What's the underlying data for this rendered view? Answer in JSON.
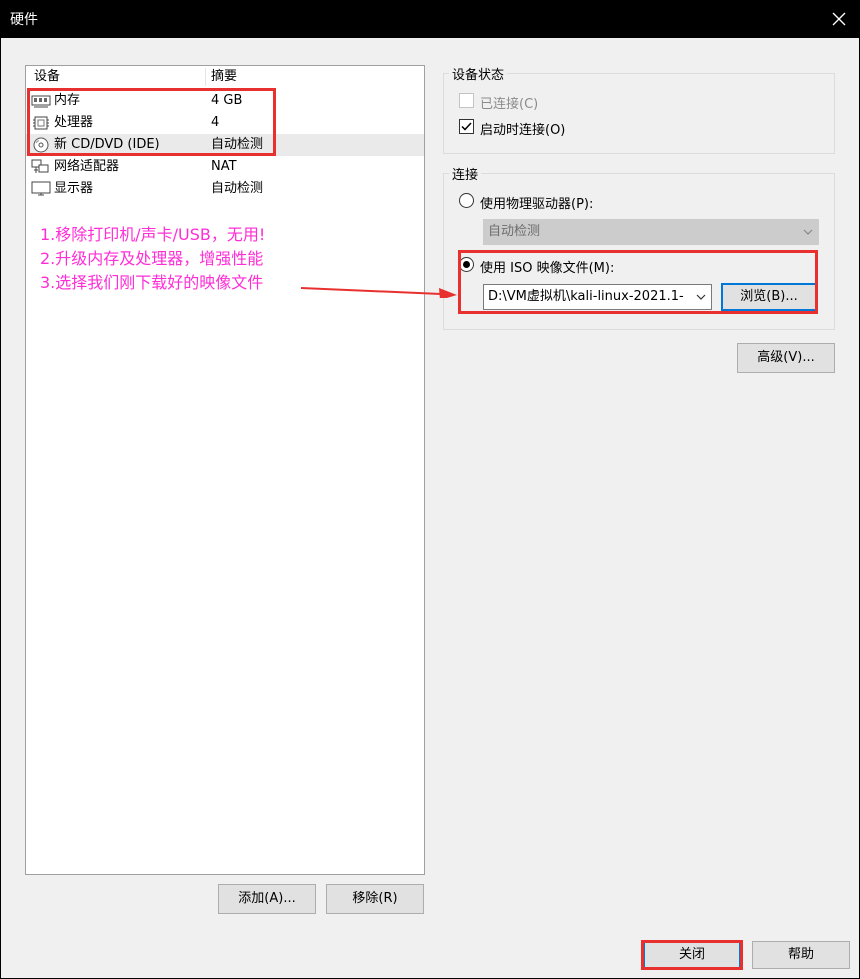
{
  "window": {
    "title": "硬件"
  },
  "device_list": {
    "columns": [
      "设备",
      "摘要"
    ],
    "rows": [
      {
        "name": "内存",
        "summary": "4 GB",
        "icon": "memory-icon"
      },
      {
        "name": "处理器",
        "summary": "4",
        "icon": "cpu-icon"
      },
      {
        "name": "新 CD/DVD (IDE)",
        "summary": "自动检测",
        "icon": "cd-dvd-icon"
      },
      {
        "name": "网络适配器",
        "summary": "NAT",
        "icon": "network-adapter-icon"
      },
      {
        "name": "显示器",
        "summary": "自动检测",
        "icon": "display-icon"
      }
    ],
    "add_button": "添加(A)...",
    "remove_button": "移除(R)"
  },
  "device_status": {
    "title": "设备状态",
    "connected_label": "已连接(C)",
    "connected_checked": false,
    "connect_on_start_label": "启动时连接(O)",
    "connect_on_start_checked": true
  },
  "connection": {
    "title": "连接",
    "physical_drive_label": "使用物理驱动器(P):",
    "physical_drive_value": "自动检测",
    "iso_label": "使用 ISO 映像文件(M):",
    "iso_value": "D:\\VM虚拟机\\kali-linux-2021.1-",
    "browse_button": "浏览(B)...",
    "selected": "iso"
  },
  "advanced_button": "高级(V)...",
  "footer": {
    "close_button": "关闭",
    "help_button": "帮助"
  },
  "annotations": [
    "1.移除打印机/声卡/USB，无用!",
    "2.升级内存及处理器，增强性能",
    "3.选择我们刚下载好的映像文件"
  ],
  "colors": {
    "highlight_box": "#e8312f",
    "annotation_text": "#ff2dd6",
    "arrow": "#e8312f"
  }
}
